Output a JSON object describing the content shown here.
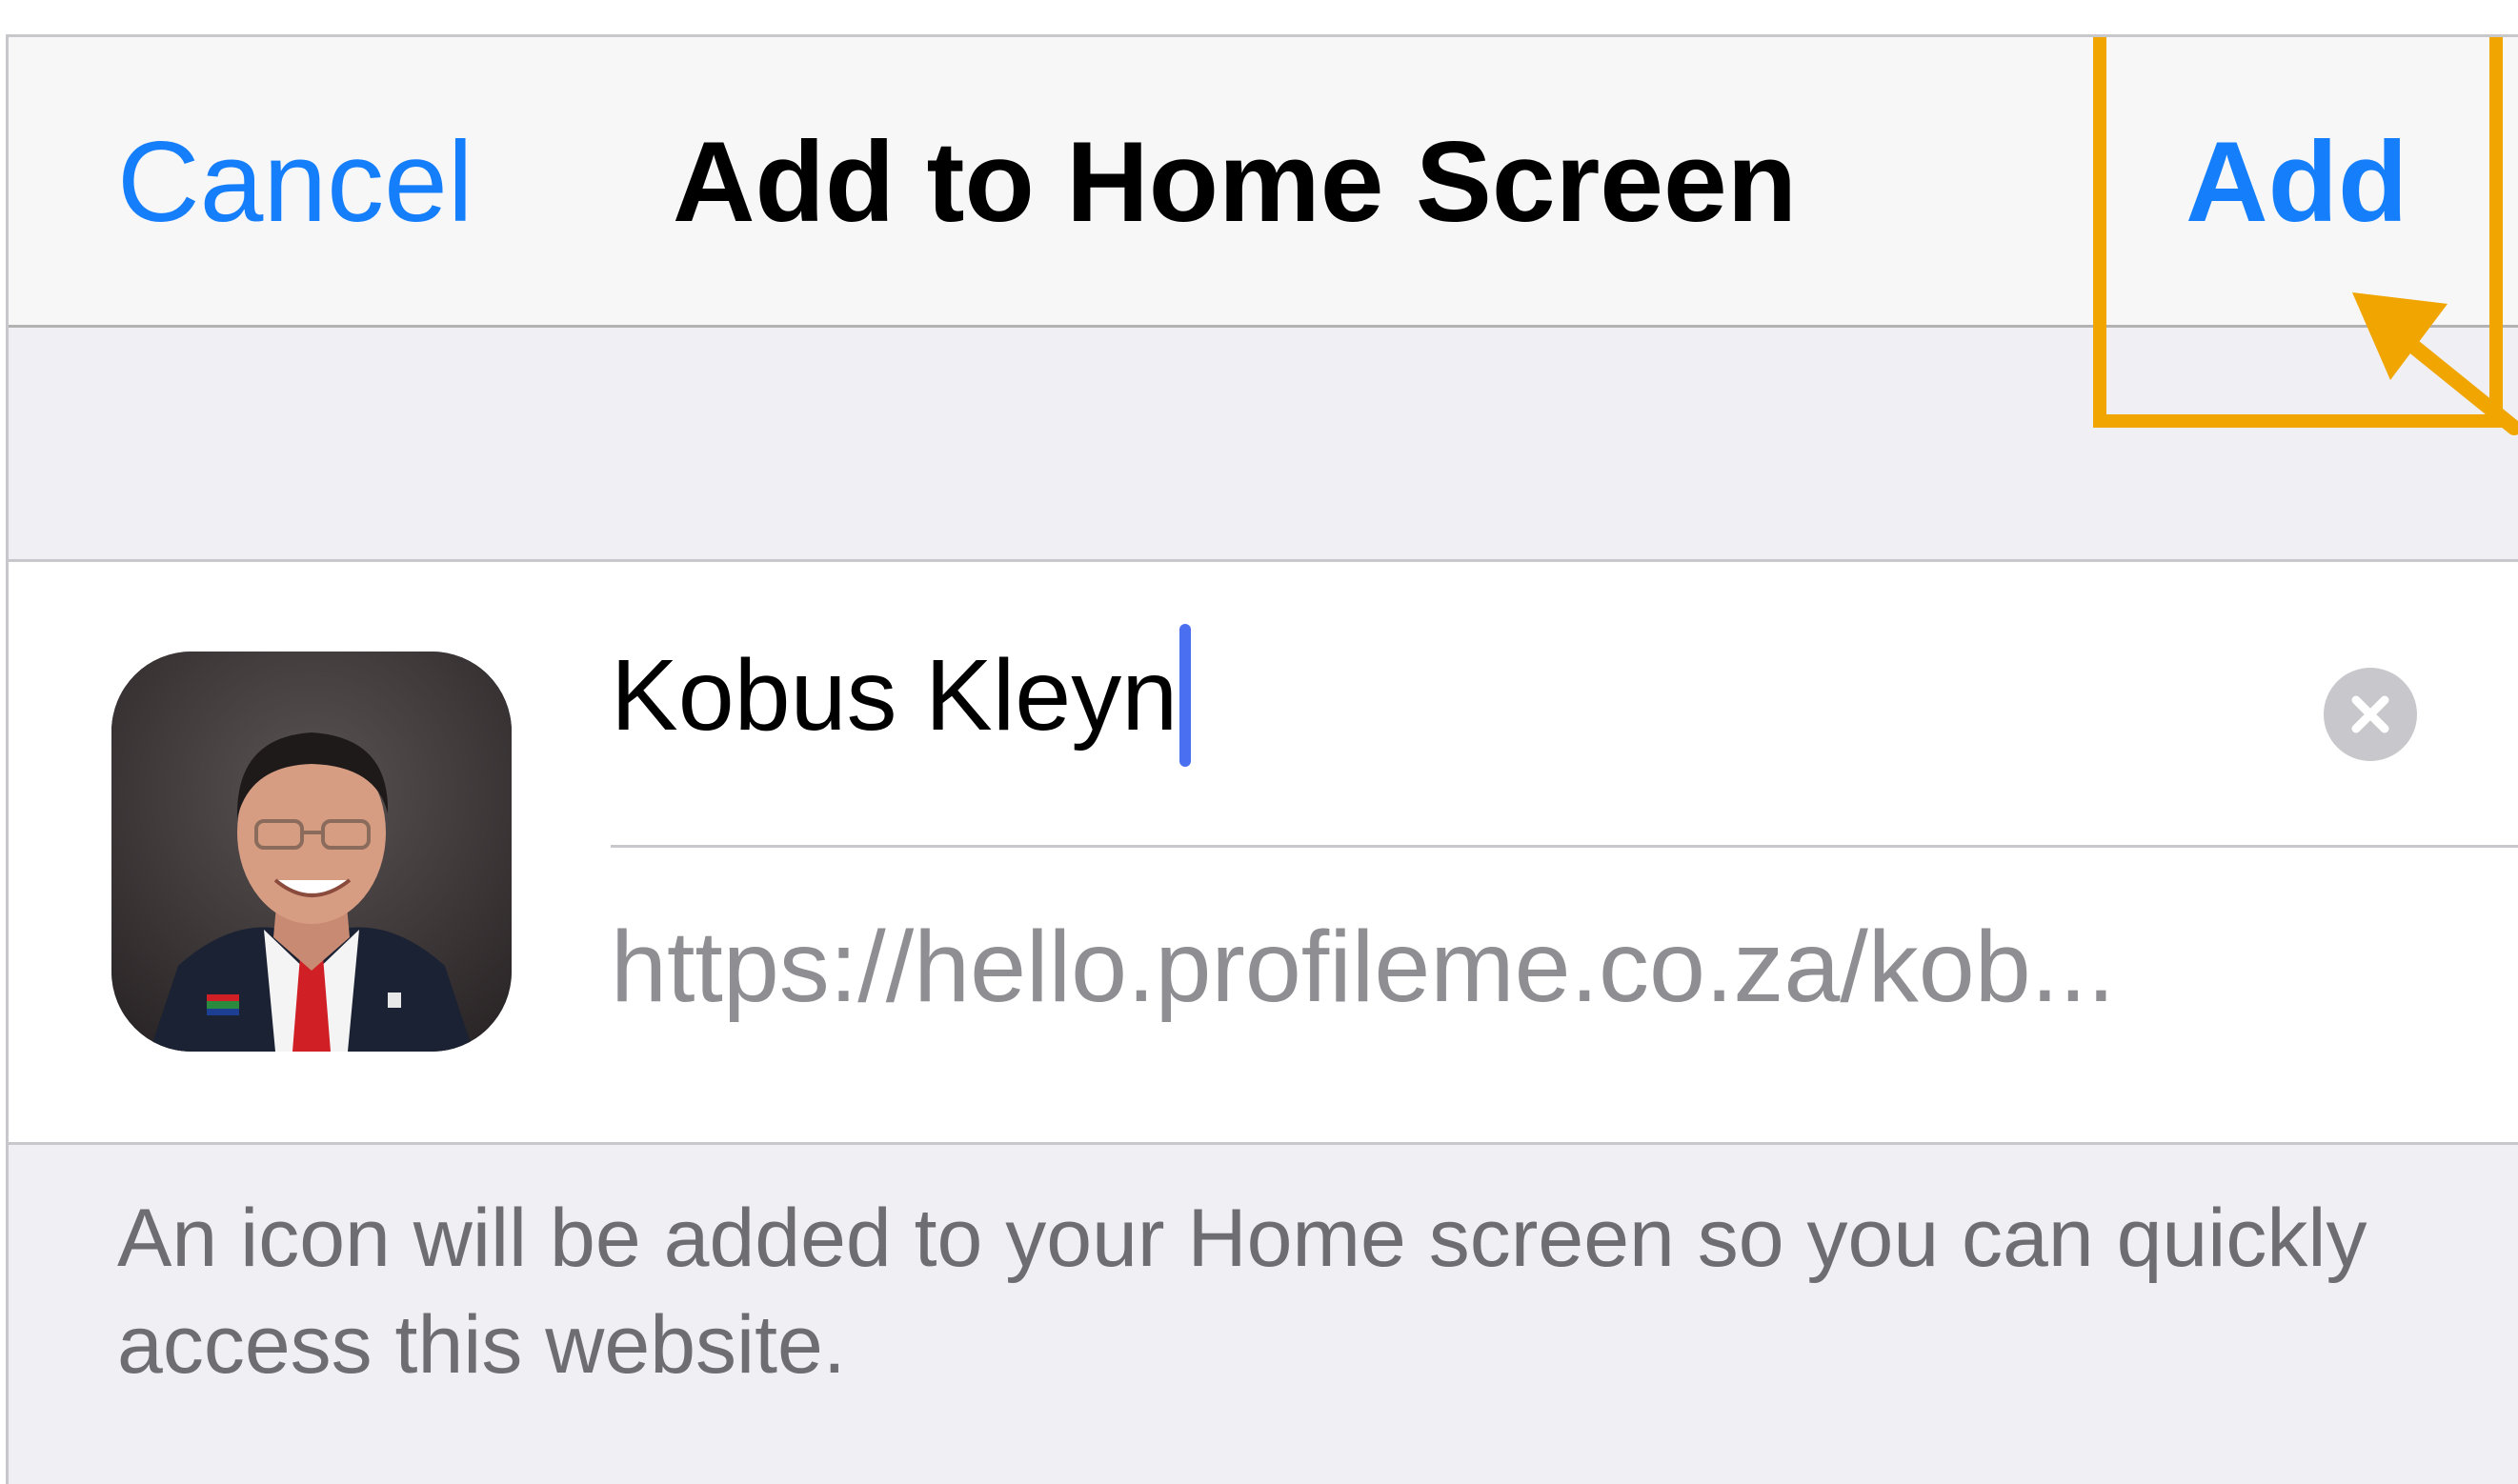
{
  "navbar": {
    "cancel_label": "Cancel",
    "title": "Add to Home Screen",
    "add_label": "Add"
  },
  "form": {
    "name_value": "Kobus Kleyn",
    "url_value": "https://hello.profileme.co.za/kob..."
  },
  "footer": {
    "note": "An icon will be added to your Home screen so you can quickly access this website."
  },
  "icons": {
    "app_icon": "profile-photo-icon",
    "clear": "clear-circle-icon",
    "annotation": "arrow-pointer-icon"
  },
  "colors": {
    "accent": "#157efb",
    "highlight": "#f0a500",
    "caret": "#4a6ff0"
  }
}
